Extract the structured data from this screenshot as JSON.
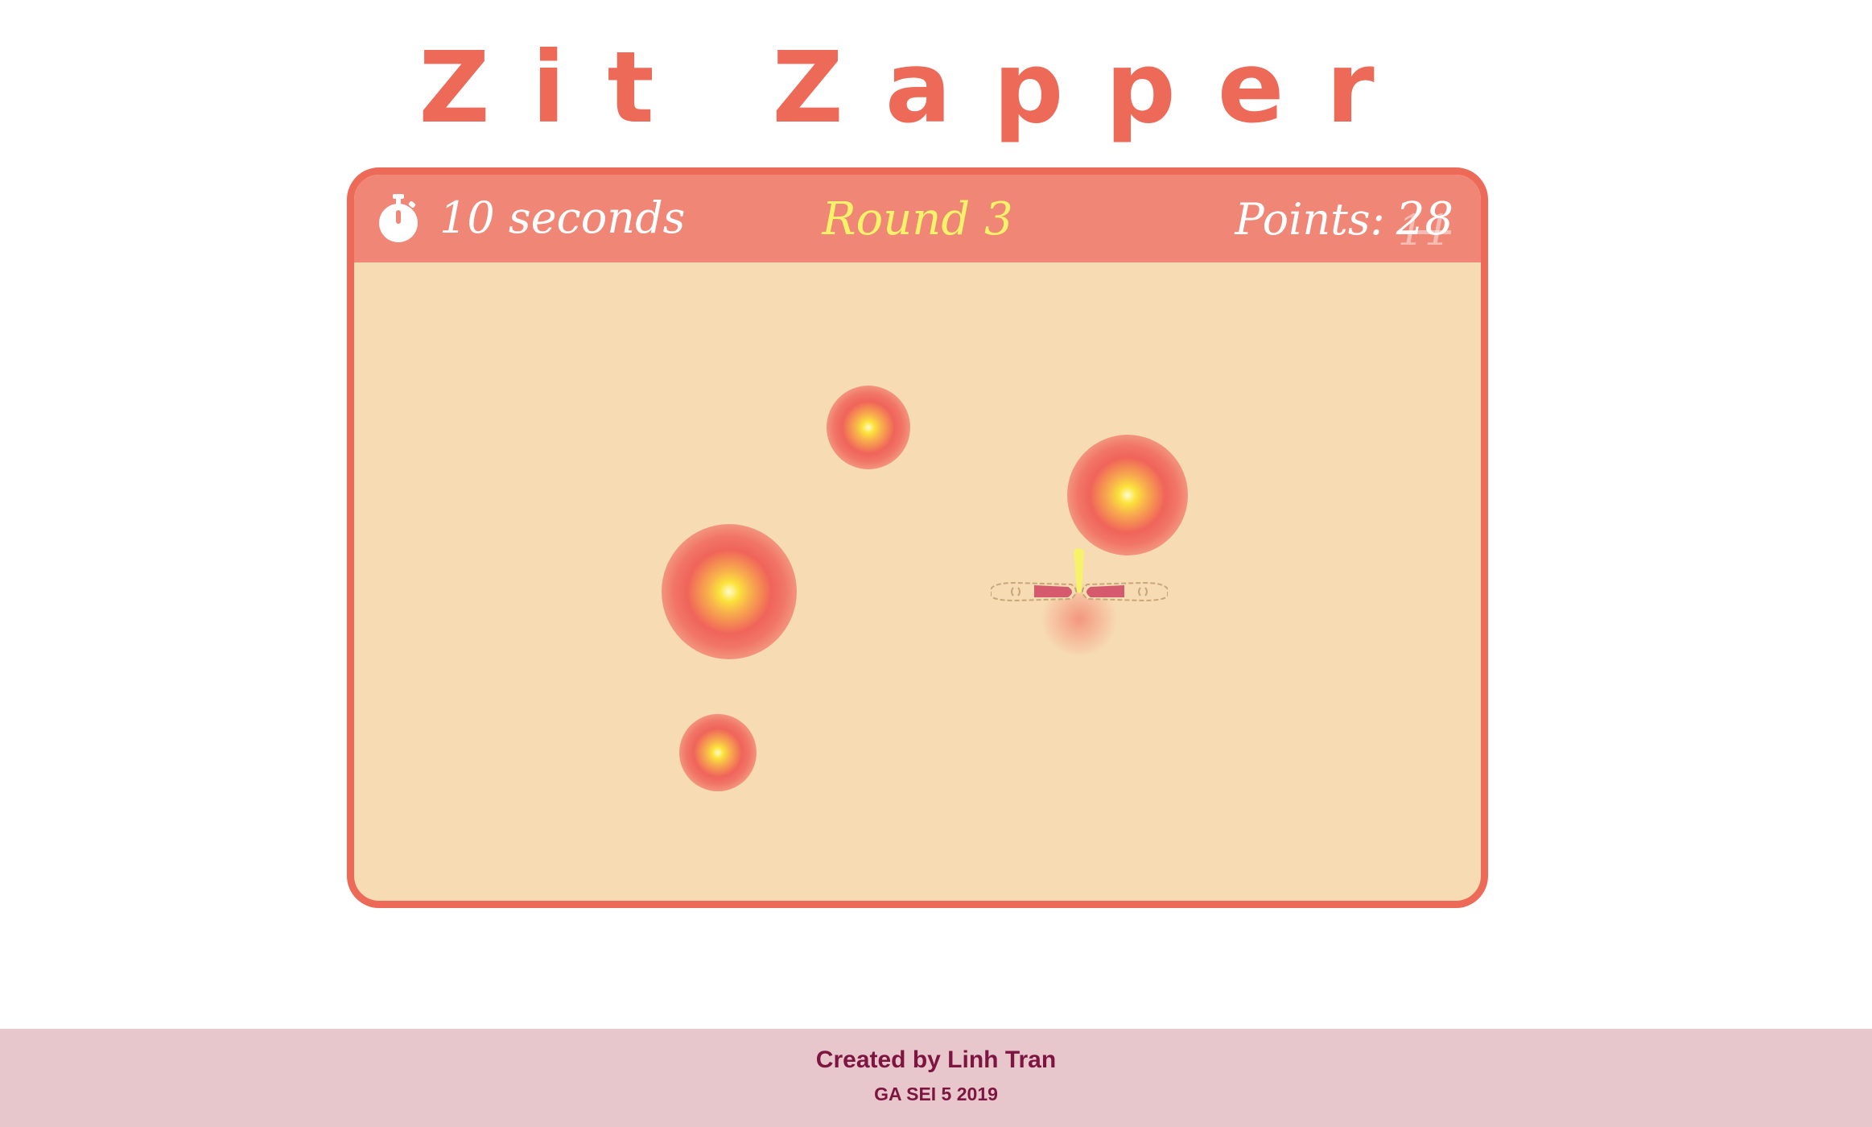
{
  "game": {
    "title": "Zit Zapper"
  },
  "hud": {
    "timer_icon": "stopwatch-icon",
    "timer_text": "10 seconds",
    "round_text": "Round 3",
    "points_label": "Points:",
    "points_previous": "11",
    "points_value": "28"
  },
  "zits": [
    {
      "name": "zit-small-top"
    },
    {
      "name": "zit-large-right"
    },
    {
      "name": "zit-large-left"
    },
    {
      "name": "zit-small-bottom"
    }
  ],
  "popped_zit": {
    "name": "popped-zit-with-fingers"
  },
  "footer": {
    "credit": "Created by Linh Tran",
    "subtitle": "GA SEI 5 2019"
  },
  "colors": {
    "accent": "#ee6a58",
    "hud_bar": "#ef8676",
    "board": "#f7dbb2",
    "round_text": "#f6f36a",
    "footer_bg": "#e7c6cc",
    "footer_text": "#7e1540"
  }
}
